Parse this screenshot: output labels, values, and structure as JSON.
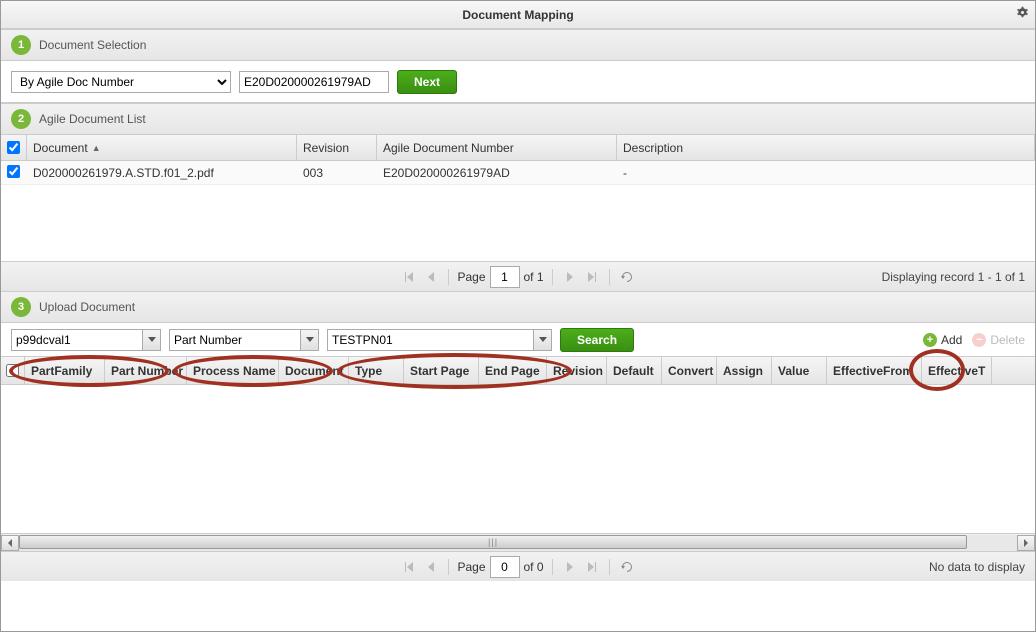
{
  "title": "Document Mapping",
  "step1": {
    "num": "1",
    "title": "Document Selection",
    "mode_options": [
      "By Agile Doc Number"
    ],
    "mode_selected": "By Agile Doc Number",
    "doc_number": "E20D020000261979AD",
    "next_label": "Next"
  },
  "step2": {
    "num": "2",
    "title": "Agile Document List",
    "columns": {
      "document": "Document",
      "revision": "Revision",
      "agile_doc_num": "Agile Document Number",
      "description": "Description"
    },
    "rows": [
      {
        "checked": true,
        "document": "D020000261979.A.STD.f01_2.pdf",
        "revision": "003",
        "agile_doc_num": "E20D020000261979AD",
        "description": "-"
      }
    ],
    "paging": {
      "page_label": "Page",
      "page": "1",
      "of_label": "of 1",
      "status": "Displaying record 1 - 1 of 1"
    }
  },
  "step3": {
    "num": "3",
    "title": "Upload Document",
    "combo1": "p99dcval1",
    "combo2": "Part Number",
    "combo3": "TESTPN01",
    "search_label": "Search",
    "add_label": "Add",
    "delete_label": "Delete",
    "columns": [
      "PartFamily",
      "Part Number",
      "Process Name",
      "Document",
      "Type",
      "Start Page",
      "End Page",
      "Revision",
      "Default",
      "Convert",
      "Assign",
      "Value",
      "EffectiveFrom",
      "EffectiveT"
    ],
    "paging": {
      "page_label": "Page",
      "page": "0",
      "of_label": "of 0",
      "status": "No data to display"
    }
  }
}
